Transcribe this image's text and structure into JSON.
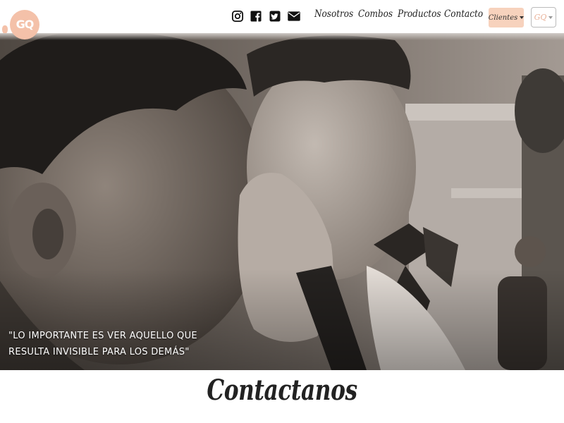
{
  "brand": {
    "logo_text": "GQ",
    "logo_subtext": "",
    "color": "#f4c1a9"
  },
  "social": [
    {
      "name": "instagram",
      "icon": "instagram-icon"
    },
    {
      "name": "facebook",
      "icon": "facebook-icon"
    },
    {
      "name": "twitter",
      "icon": "twitter-icon"
    },
    {
      "name": "email",
      "icon": "envelope-icon"
    }
  ],
  "nav": {
    "items": [
      {
        "label": "Nosotros"
      },
      {
        "label": "Combos"
      },
      {
        "label": "Productos"
      },
      {
        "label": "Contacto"
      }
    ],
    "clientes_label": "Clientes",
    "gq_label": "GQ"
  },
  "hero": {
    "caption_line1": "\"LO IMPORTANTE ES VER AQUELLO QUE",
    "caption_line2": "RESULTA INVISIBLE PARA LOS DEMÁS\"",
    "image": "sepia-photo-father-kissing-child"
  },
  "section": {
    "title": "Contactanos"
  },
  "colors": {
    "accent": "#f7d2bd",
    "text": "#222222",
    "sepia": "#6e665f"
  }
}
